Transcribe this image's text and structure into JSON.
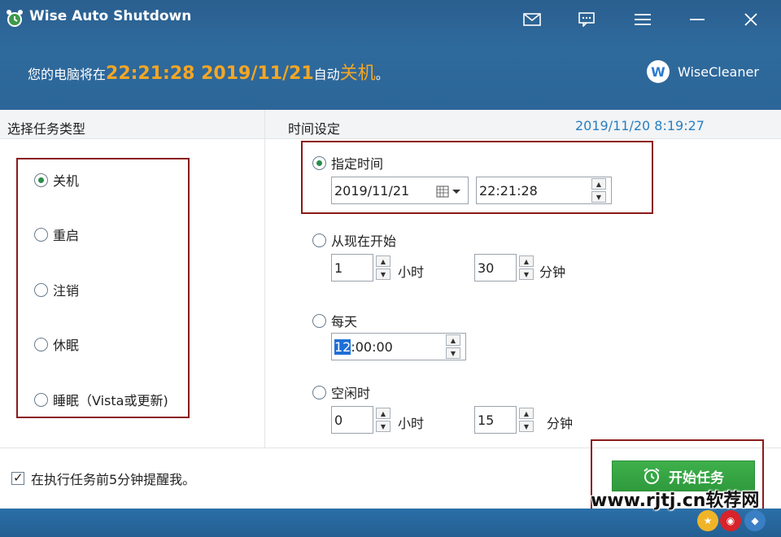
{
  "window": {
    "title": "Wise Auto Shutdown"
  },
  "status": {
    "prefix": "您的电脑将在",
    "time": "22:21:28 2019/11/21",
    "middle": "自动",
    "action": "关机",
    "suffix": "。"
  },
  "brand": {
    "logo_letter": "W",
    "name": "WiseCleaner"
  },
  "task_panel": {
    "header": "选择任务类型",
    "options": [
      {
        "label": "关机",
        "selected": true
      },
      {
        "label": "重启",
        "selected": false
      },
      {
        "label": "注销",
        "selected": false
      },
      {
        "label": "休眠",
        "selected": false
      },
      {
        "label": "睡眠（Vista或更新)",
        "selected": false
      }
    ]
  },
  "time_panel": {
    "header": "时间设定",
    "current_time": "2019/11/20 8:19:27",
    "specified": {
      "label": "指定时间",
      "date": "2019/11/21",
      "time": "22:21:28"
    },
    "from_now": {
      "label": "从现在开始",
      "hours": "1",
      "hours_unit": "小时",
      "minutes": "30",
      "minutes_unit": "分钟"
    },
    "daily": {
      "label": "每天",
      "time_selected": "12",
      "time_rest": ":00:00"
    },
    "idle": {
      "label": "空闲时",
      "hours": "0",
      "hours_unit": "小时",
      "minutes": "15",
      "minutes_unit": "分钟"
    }
  },
  "footer": {
    "remind_label": "在执行任务前5分钟提醒我。",
    "start_label": "开始任务"
  },
  "watermark": "www.rjtj.cn软荐网"
}
